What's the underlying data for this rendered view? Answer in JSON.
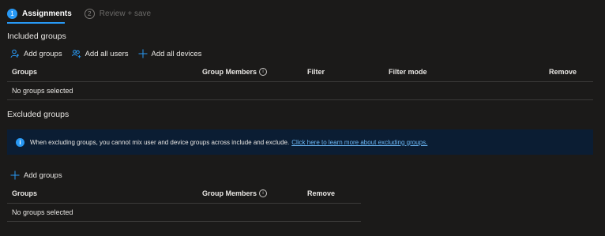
{
  "wizard": {
    "steps": [
      {
        "number": "1",
        "label": "Assignments"
      },
      {
        "number": "2",
        "label": "Review + save"
      }
    ]
  },
  "included": {
    "title": "Included groups",
    "commands": {
      "add_groups": "Add groups",
      "add_all_users": "Add all users",
      "add_all_devices": "Add all devices"
    },
    "columns": {
      "groups": "Groups",
      "group_members": "Group Members",
      "filter": "Filter",
      "filter_mode": "Filter mode",
      "remove": "Remove"
    },
    "empty_text": "No groups selected"
  },
  "excluded": {
    "title": "Excluded groups",
    "banner": {
      "icon": "i",
      "text": "When excluding groups, you cannot mix user and device groups across include and exclude.",
      "link": "Click here to learn more about excluding groups."
    },
    "commands": {
      "add_groups": "Add groups"
    },
    "columns": {
      "groups": "Groups",
      "group_members": "Group Members",
      "remove": "Remove"
    },
    "empty_text": "No groups selected"
  },
  "info_glyph": "i",
  "colors": {
    "background": "#1b1a19",
    "accent": "#2899f5",
    "banner_bg": "#0b1d33",
    "link": "#6cb8f6"
  },
  "icons": [
    "person-add-icon",
    "people-add-icon",
    "plus-icon",
    "info-icon"
  ]
}
